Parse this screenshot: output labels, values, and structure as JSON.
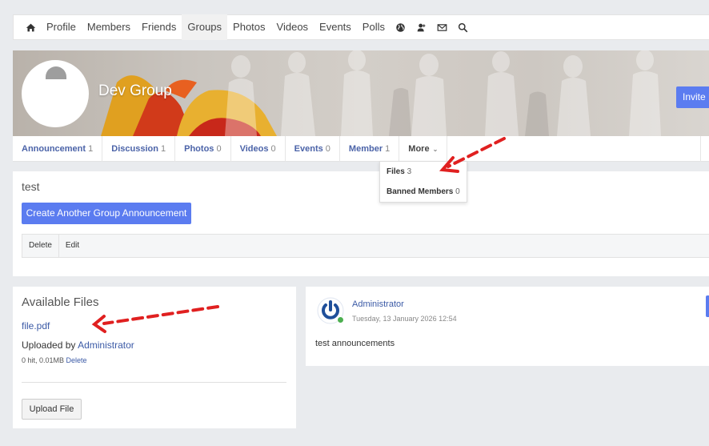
{
  "topnav": {
    "items": [
      {
        "label": "Profile"
      },
      {
        "label": "Members"
      },
      {
        "label": "Friends"
      },
      {
        "label": "Groups",
        "active": true
      },
      {
        "label": "Photos"
      },
      {
        "label": "Videos"
      },
      {
        "label": "Events"
      },
      {
        "label": "Polls"
      }
    ],
    "icons": [
      "home-icon",
      "globe-icon",
      "friend-request-icon",
      "mail-icon",
      "search-icon"
    ]
  },
  "group": {
    "name": "Dev Group",
    "invite_label": "Invite F"
  },
  "tabs": [
    {
      "label": "Announcement",
      "count": "1"
    },
    {
      "label": "Discussion",
      "count": "1"
    },
    {
      "label": "Photos",
      "count": "0"
    },
    {
      "label": "Videos",
      "count": "0"
    },
    {
      "label": "Events",
      "count": "0"
    },
    {
      "label": "Member",
      "count": "1"
    },
    {
      "label": "More",
      "count": ""
    }
  ],
  "more_dropdown": [
    {
      "label": "Files",
      "count": "3"
    },
    {
      "label": "Banned Members",
      "count": "0"
    }
  ],
  "announcement": {
    "title": "test",
    "create_label": "Create Another Group Announcement",
    "actions": [
      "Delete",
      "Edit"
    ]
  },
  "files": {
    "title": "Available Files",
    "file_name": "file.pdf",
    "uploaded_prefix": "Uploaded by ",
    "uploaded_by": "Administrator",
    "meta": "0 hit, 0.01MB ",
    "delete_label": "Delete",
    "upload_label": "Upload File"
  },
  "post": {
    "author": "Administrator",
    "timestamp": "Tuesday, 13 January 2026 12:54",
    "text": "test announcements"
  },
  "colors": {
    "accent": "#5b7cf0",
    "link": "#3b5aa6",
    "online": "#4caf50",
    "annotation": "#e02020"
  }
}
